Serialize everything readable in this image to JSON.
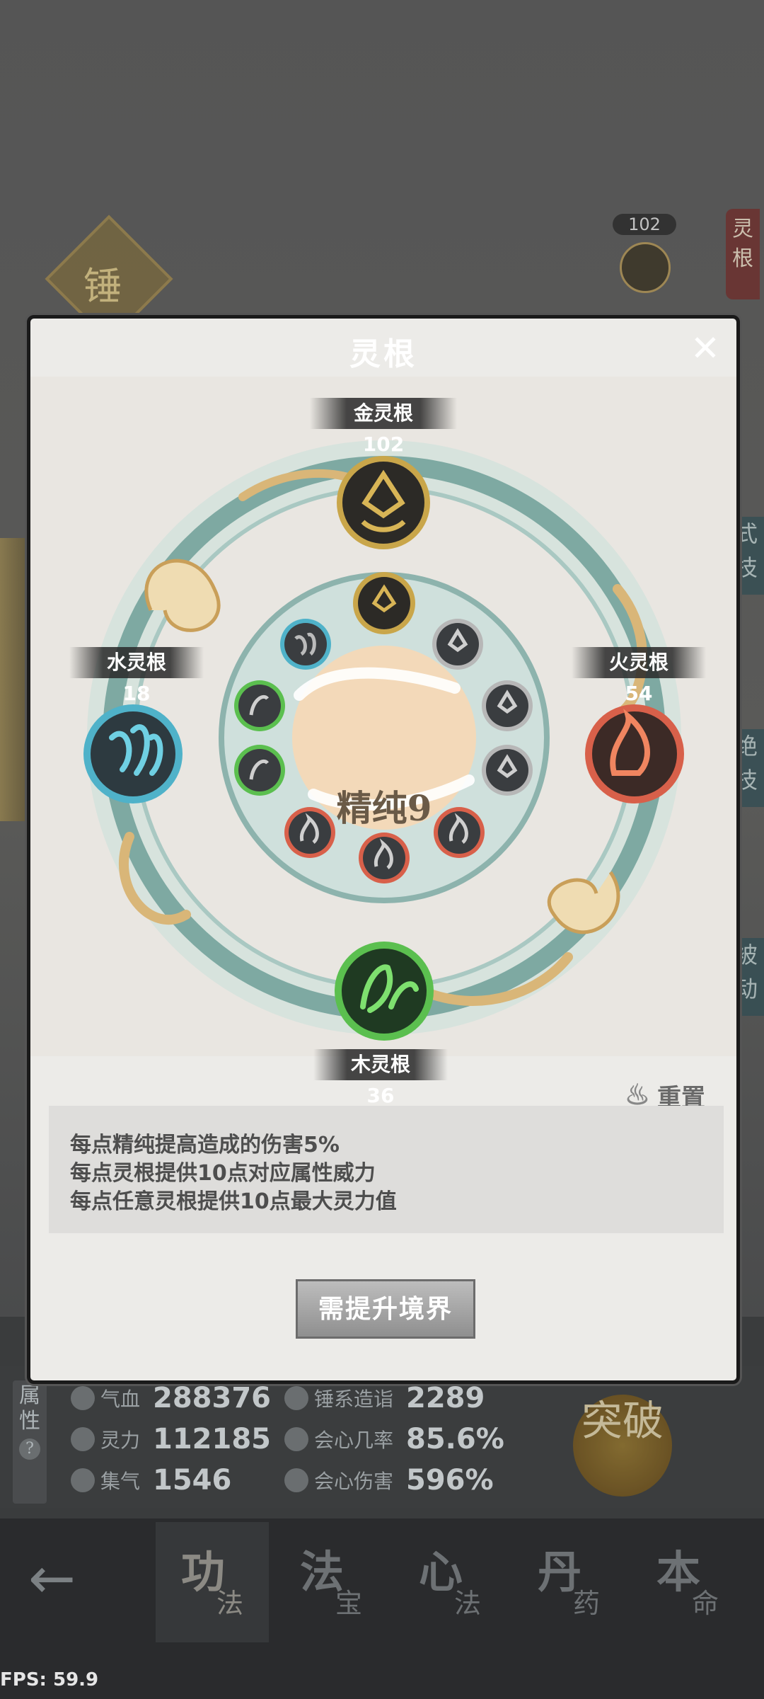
{
  "background": {
    "hammer_label": "锤",
    "top_value": "102",
    "side_tab_top": "灵根",
    "right_tabs": [
      "式技",
      "绝技",
      "被动"
    ]
  },
  "modal": {
    "title": "灵根",
    "close_label": "✕",
    "roots": {
      "gold": "金灵根102",
      "water": "水灵根18",
      "fire": "火灵根54",
      "wood": "木灵根36"
    },
    "center_label": "精纯9",
    "reset_label": "重置",
    "description": [
      "每点精纯提高造成的伤害5%",
      "每点灵根提供10点对应属性威力",
      "每点任意灵根提供10点最大灵力值"
    ],
    "upgrade_button": "需提升境界"
  },
  "stats": {
    "side_label": "属性",
    "items": [
      {
        "icon": "heart-icon",
        "label": "气血",
        "value": "288376"
      },
      {
        "icon": "drop-icon",
        "label": "灵力",
        "value": "112185"
      },
      {
        "icon": "swirl-icon",
        "label": "集气",
        "value": "1546"
      },
      {
        "icon": "hammer-skill-icon",
        "label": "锤系造诣",
        "value": "2289"
      },
      {
        "icon": "target-icon",
        "label": "会心几率",
        "value": "85.6%"
      },
      {
        "icon": "burst-icon",
        "label": "会心伤害",
        "value": "596%"
      }
    ],
    "breakthrough": "突破"
  },
  "nav": {
    "back": "←",
    "tabs": [
      {
        "big": "功",
        "small": "法"
      },
      {
        "big": "法",
        "small": "宝"
      },
      {
        "big": "心",
        "small": "法"
      },
      {
        "big": "丹",
        "small": "药"
      },
      {
        "big": "本",
        "small": "命"
      }
    ]
  },
  "fps": "FPS: 59.9",
  "colors": {
    "gold": "#c9a64a",
    "water": "#4fb2c9",
    "fire": "#d8604a",
    "wood": "#5bbf4f",
    "header": "#8fb4b9"
  }
}
